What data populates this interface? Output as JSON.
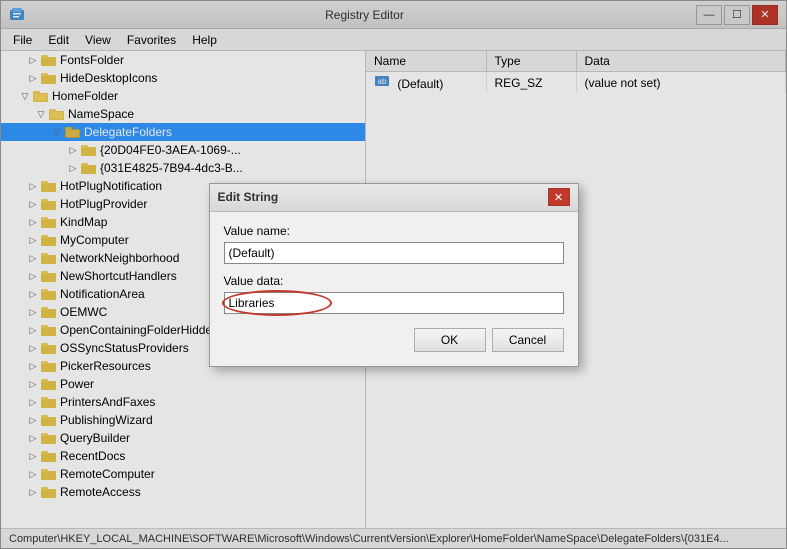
{
  "window": {
    "title": "Registry Editor",
    "icon": "registry-icon",
    "controls": {
      "minimize": "—",
      "maximize": "☐",
      "close": "✕"
    }
  },
  "menu": {
    "items": [
      "File",
      "Edit",
      "View",
      "Favorites",
      "Help"
    ]
  },
  "tree": {
    "items": [
      {
        "id": "fonts-folder",
        "label": "FontsFolder",
        "indent": 1,
        "expanded": false,
        "level": 2
      },
      {
        "id": "hide-desktop-icons",
        "label": "HideDesktopIcons",
        "indent": 1,
        "expanded": false,
        "level": 2
      },
      {
        "id": "home-folder",
        "label": "HomeFolder",
        "indent": 1,
        "expanded": true,
        "level": 2
      },
      {
        "id": "namespace",
        "label": "NameSpace",
        "indent": 2,
        "expanded": true,
        "level": 3
      },
      {
        "id": "delegate-folders",
        "label": "DelegateFolders",
        "indent": 3,
        "expanded": true,
        "level": 4,
        "selected": true
      },
      {
        "id": "guid1",
        "label": "{20D04FE0-3AEA-1069-...",
        "indent": 4,
        "expanded": false,
        "level": 5
      },
      {
        "id": "guid2",
        "label": "{031E4825-7B94-4dc3-B...",
        "indent": 4,
        "expanded": false,
        "level": 5
      },
      {
        "id": "hot-plug-notification",
        "label": "HotPlugNotification",
        "indent": 1,
        "expanded": false,
        "level": 2
      },
      {
        "id": "hot-plug-provider",
        "label": "HotPlugProvider",
        "indent": 1,
        "expanded": false,
        "level": 2
      },
      {
        "id": "kind-map",
        "label": "KindMap",
        "indent": 1,
        "expanded": false,
        "level": 2
      },
      {
        "id": "my-computer",
        "label": "MyComputer",
        "indent": 1,
        "expanded": false,
        "level": 2
      },
      {
        "id": "network-neighborhood",
        "label": "NetworkNeighborhood",
        "indent": 1,
        "expanded": false,
        "level": 2
      },
      {
        "id": "new-shortcut-handlers",
        "label": "NewShortcutHandlers",
        "indent": 1,
        "expanded": false,
        "level": 2
      },
      {
        "id": "notification-area",
        "label": "NotificationArea",
        "indent": 1,
        "expanded": false,
        "level": 2
      },
      {
        "id": "oemwc",
        "label": "OEMWC",
        "indent": 1,
        "expanded": false,
        "level": 2
      },
      {
        "id": "open-containing-folder",
        "label": "OpenContainingFolderHiddenList",
        "indent": 1,
        "expanded": false,
        "level": 2
      },
      {
        "id": "os-sync-status",
        "label": "OSSyncStatusProviders",
        "indent": 1,
        "expanded": false,
        "level": 2
      },
      {
        "id": "picker-resources",
        "label": "PickerResources",
        "indent": 1,
        "expanded": false,
        "level": 2
      },
      {
        "id": "power",
        "label": "Power",
        "indent": 1,
        "expanded": false,
        "level": 2
      },
      {
        "id": "printers-faxes",
        "label": "PrintersAndFaxes",
        "indent": 1,
        "expanded": false,
        "level": 2
      },
      {
        "id": "publishing-wizard",
        "label": "PublishingWizard",
        "indent": 1,
        "expanded": false,
        "level": 2
      },
      {
        "id": "query-builder",
        "label": "QueryBuilder",
        "indent": 1,
        "expanded": false,
        "level": 2
      },
      {
        "id": "recent-docs",
        "label": "RecentDocs",
        "indent": 1,
        "expanded": false,
        "level": 2
      },
      {
        "id": "remote-computer",
        "label": "RemoteComputer",
        "indent": 1,
        "expanded": false,
        "level": 2
      },
      {
        "id": "remote-access",
        "label": "RemoteAccess",
        "indent": 1,
        "expanded": false,
        "level": 2
      }
    ]
  },
  "registry_table": {
    "columns": [
      "Name",
      "Type",
      "Data"
    ],
    "rows": [
      {
        "name": "(Default)",
        "type": "REG_SZ",
        "data": "(value not set)",
        "icon": "registry-value-icon"
      }
    ]
  },
  "dialog": {
    "title": "Edit String",
    "value_name_label": "Value name:",
    "value_name": "(Default)",
    "value_data_label": "Value data:",
    "value_data": "Libraries",
    "ok_label": "OK",
    "cancel_label": "Cancel"
  },
  "status_bar": {
    "text": "Computer\\HKEY_LOCAL_MACHINE\\SOFTWARE\\Microsoft\\Windows\\CurrentVersion\\Explorer\\HomeFolder\\NameSpace\\DelegateFolders\\{031E4..."
  }
}
